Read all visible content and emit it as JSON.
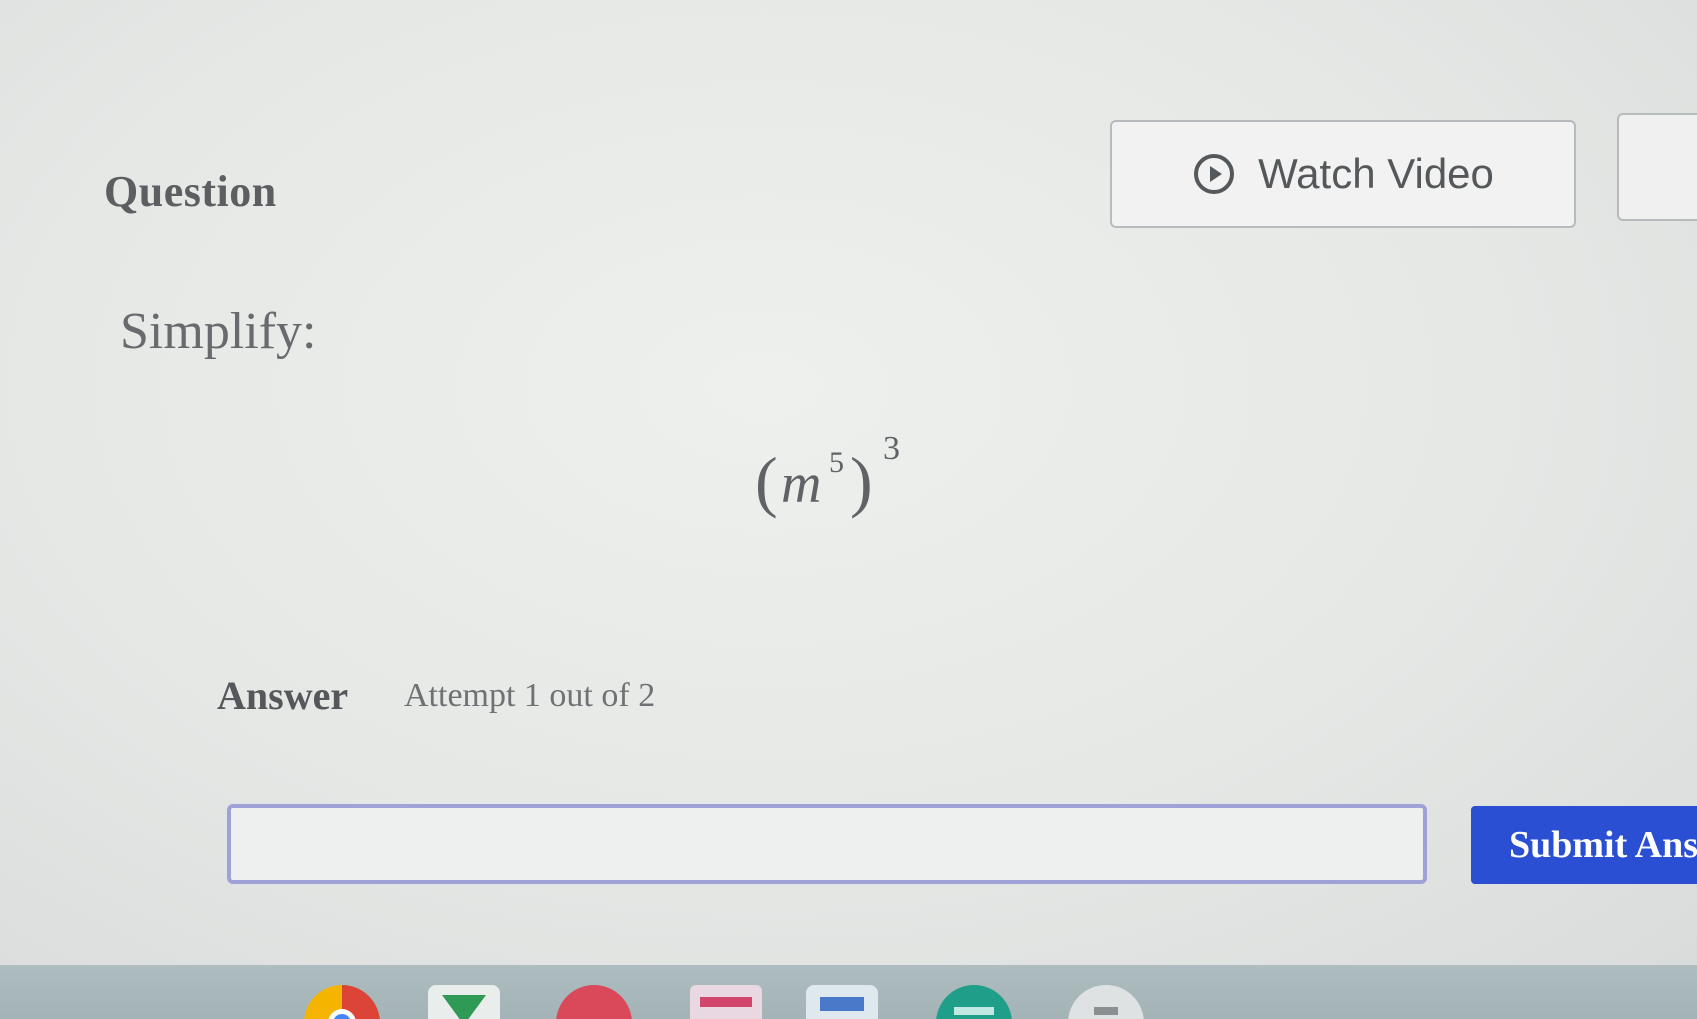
{
  "question": {
    "heading": "Question",
    "watch_video_label": "Watch Video",
    "prompt": "Simplify:",
    "expression": {
      "base": "m",
      "inner_exponent": "5",
      "outer_exponent": "3"
    }
  },
  "answer": {
    "heading": "Answer",
    "attempt_text": "Attempt 1 out of 2",
    "input_value": "",
    "submit_label": "Submit Answer"
  },
  "colors": {
    "submit_button": "#2a4fd2",
    "input_border": "#9ea2d6",
    "taskbar": "#a3b3b6"
  },
  "taskbar": {
    "apps": [
      "chrome-icon",
      "app-icon-green",
      "app-icon-red",
      "app-icon-pink",
      "app-icon-blue",
      "app-icon-teal",
      "app-icon-gray"
    ]
  }
}
